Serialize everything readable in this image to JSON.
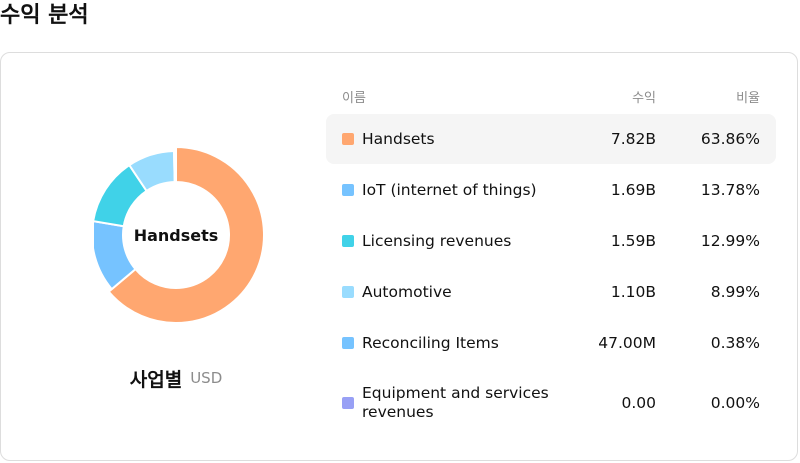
{
  "page": {
    "title": "수익 분석"
  },
  "chart_data": {
    "type": "pie",
    "center_label": "Handsets",
    "caption": "사업별",
    "unit": "USD",
    "columns": {
      "name": "이름",
      "revenue": "수익",
      "percent": "비율"
    },
    "active_index": 0,
    "series": [
      {
        "name": "Handsets",
        "revenue": "7.82B",
        "percent": "63.86%",
        "value": 63.86,
        "color": "#ffa770"
      },
      {
        "name": "IoT (internet of things)",
        "revenue": "1.69B",
        "percent": "13.78%",
        "value": 13.78,
        "color": "#76c3ff"
      },
      {
        "name": "Licensing revenues",
        "revenue": "1.59B",
        "percent": "12.99%",
        "value": 12.99,
        "color": "#40d2e8"
      },
      {
        "name": "Automotive",
        "revenue": "1.10B",
        "percent": "8.99%",
        "value": 8.99,
        "color": "#99dcfe"
      },
      {
        "name": "Reconciling Items",
        "revenue": "47.00M",
        "percent": "0.38%",
        "value": 0.38,
        "color": "#76c3ff"
      },
      {
        "name": "Equipment and services revenues",
        "revenue": "0.00",
        "percent": "0.00%",
        "value": 0.0,
        "color": "#98a0f5"
      }
    ]
  }
}
